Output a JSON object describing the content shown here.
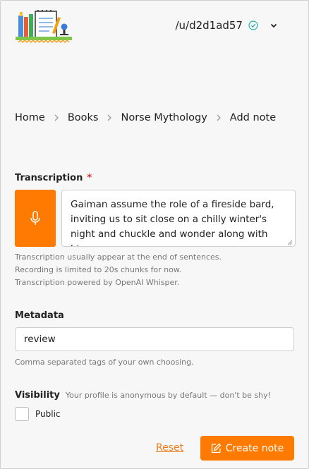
{
  "header": {
    "username": "/u/d2d1ad57",
    "logo_icon": "books-notepad-microphone-logo",
    "verified_icon": "check-circle-icon",
    "menu_icon": "chevron-down-icon"
  },
  "breadcrumb": [
    "Home",
    "Books",
    "Norse Mythology",
    "Add note"
  ],
  "transcription": {
    "label": "Transcription",
    "required_mark": "*",
    "value": "Gaiman assume the role of a fireside bard, inviting us to sit close on a chilly winter's night and chuckle and wonder along with him.",
    "help": [
      "Transcription usually appear at the end of sentences.",
      "Recording is limited to 20s chunks for now.",
      "Transcription powered by OpenAI Whisper."
    ]
  },
  "metadata": {
    "label": "Metadata",
    "value": "review",
    "help": "Comma separated tags of your own choosing."
  },
  "visibility": {
    "label": "Visibility",
    "note": "Your profile is anonymous by default — don't be shy!",
    "checkbox_label": "Public",
    "checked": false
  },
  "actions": {
    "reset": "Reset",
    "create": "Create note"
  },
  "colors": {
    "accent": "#ff7a00",
    "required": "#e03131",
    "verified": "#20b2aa"
  }
}
